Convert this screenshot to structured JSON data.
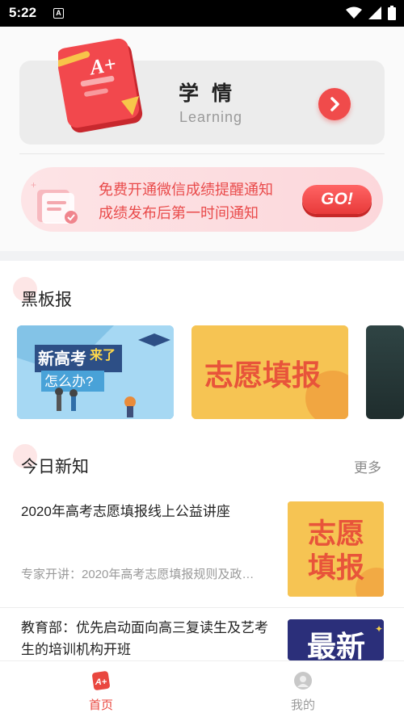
{
  "status_bar": {
    "time": "5:22",
    "a_icon_text": "A"
  },
  "learning": {
    "title": "学情",
    "subtitle": "Learning",
    "book_badge": "A+"
  },
  "notify": {
    "line1": "免费开通微信成绩提醒通知",
    "line2": "成绩发布后第一时间通知",
    "go_label": "GO!"
  },
  "blackboard": {
    "title": "黑板报",
    "banners": [
      {
        "text_prefix": "新高考",
        "text_mid": "来了",
        "text_sub": "怎么办?"
      },
      {
        "text": "志愿填报"
      },
      {
        "text": ""
      }
    ]
  },
  "today": {
    "title": "今日新知",
    "more": "更多",
    "items": [
      {
        "title": "2020年高考志愿填报线上公益讲座",
        "desc": "专家开讲：2020年高考志愿填报规则及政…",
        "thumb_line1": "志愿",
        "thumb_line2": "填报"
      },
      {
        "title": "教育部：优先启动面向高三复读生及艺考生的培训机构开班",
        "thumb_text": "最新"
      }
    ]
  },
  "tabbar": {
    "home_label": "首页",
    "home_icon_text": "A+",
    "mine_label": "我的"
  },
  "colors": {
    "accent": "#f04b4b",
    "tab_active": "#e9473f",
    "tab_inactive": "#9a9a9a"
  }
}
